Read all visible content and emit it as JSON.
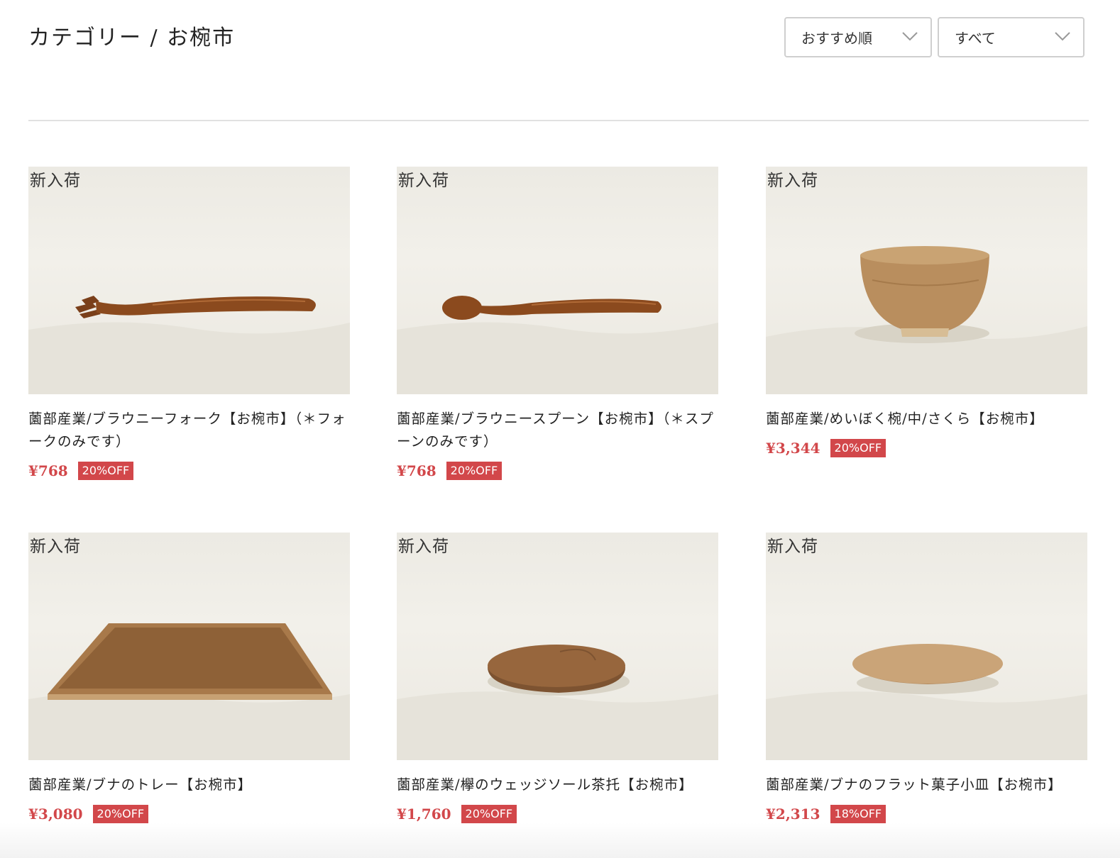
{
  "header": {
    "title": "カテゴリー / お椀市",
    "sort_select": {
      "value": "おすすめ順",
      "icon": "chevron-down-icon"
    },
    "filter_select": {
      "value": "すべて",
      "icon": "chevron-down-icon"
    }
  },
  "colors": {
    "accent": "#d2474a",
    "divider": "#e1e1e1",
    "select_border": "#cfcfcf"
  },
  "products": [
    {
      "badge": "新入荷",
      "name": "薗部産業/ブラウニーフォーク【お椀市】（＊フォークのみです）",
      "price": "¥768",
      "discount": "20%OFF",
      "image": "fork"
    },
    {
      "badge": "新入荷",
      "name": "薗部産業/ブラウニースプーン【お椀市】（＊スプーンのみです）",
      "price": "¥768",
      "discount": "20%OFF",
      "image": "spoon"
    },
    {
      "badge": "新入荷",
      "name": "薗部産業/めいぼく椀/中/さくら【お椀市】",
      "price": "¥3,344",
      "discount": "20%OFF",
      "image": "bowl"
    },
    {
      "badge": "新入荷",
      "name": "薗部産業/ブナのトレー【お椀市】",
      "price": "¥3,080",
      "discount": "20%OFF",
      "image": "tray"
    },
    {
      "badge": "新入荷",
      "name": "薗部産業/欅のウェッジソール茶托【お椀市】",
      "price": "¥1,760",
      "discount": "20%OFF",
      "image": "saucer"
    },
    {
      "badge": "新入荷",
      "name": "薗部産業/ブナのフラット菓子小皿【お椀市】",
      "price": "¥2,313",
      "discount": "18%OFF",
      "image": "plate"
    }
  ]
}
